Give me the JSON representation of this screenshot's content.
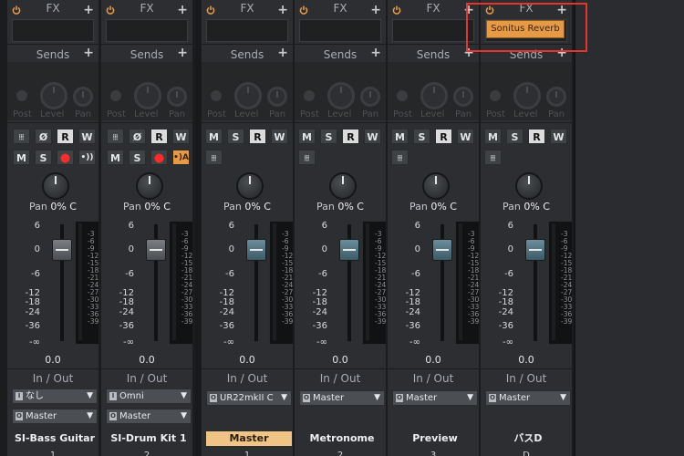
{
  "headers": {
    "fx": "FX",
    "sends": "Sends",
    "io": "In / Out",
    "post": "Post",
    "level": "Level",
    "pan": "Pan",
    "plus": "+"
  },
  "pan_readout": {
    "label": "Pan",
    "value": "0% C"
  },
  "db_scale": [
    "6",
    "0",
    "-6",
    "-12",
    "-18",
    "-24",
    "-36",
    "-∞"
  ],
  "meter_scale": [
    "-3",
    "-6",
    "-9",
    "-12",
    "-15",
    "-18",
    "-21",
    "-24",
    "-27",
    "-30",
    "-33",
    "-36",
    "-39"
  ],
  "level_value": "0.0",
  "buttons": {
    "m": "M",
    "s": "S",
    "r": "R",
    "w": "W",
    "phase": "Ø"
  },
  "fx_slot": "Sonitus Reverb",
  "strips": [
    {
      "name": "SI-Bass Guitar",
      "number": "1",
      "input": "なし",
      "output": "Master"
    },
    {
      "name": "SI-Drum Kit 1",
      "number": "2",
      "input": "Omni",
      "output": "Master"
    },
    {
      "name": "Master",
      "number": "1",
      "output": "UR22mkII C"
    },
    {
      "name": "Metronome",
      "number": "2",
      "output": "Master"
    },
    {
      "name": "Preview",
      "number": "3",
      "output": "Master"
    },
    {
      "name": "バスD",
      "number": "D",
      "output": "Master"
    }
  ],
  "colors": {
    "accent": "#e69a45",
    "highlight": "#e8322c",
    "record": "#ff2a2a",
    "master_label": "#f0c484"
  }
}
